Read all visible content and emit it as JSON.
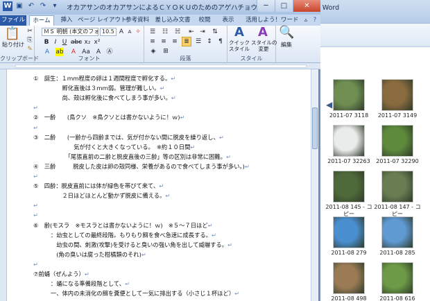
{
  "word": {
    "title": "オカアサンのオカアサンによるＣＹＯＫＵのためのアゲハチョウ観察日記 - Microsoft Word",
    "window_controls": {
      "minimize": "─",
      "maximize": "□",
      "close": "✕"
    },
    "tabs": [
      "ファイル",
      "ホーム",
      "挿入",
      "ページ レイアウト",
      "参考資料",
      "差し込み文書",
      "校閲",
      "表示",
      "活用しよう！ワード"
    ],
    "ribbon": {
      "paste_label": "貼り付け",
      "clipboard_group": "クリップボード",
      "font_name": "ＭＳ 明朝 (本文のフォン",
      "font_size": "10.5",
      "font_group": "フォント",
      "paragraph_group": "段落",
      "quick_style_label": "クイック\nスタイル",
      "change_style_label": "スタイルの\n変更",
      "style_group": "スタイル",
      "edit_label": "編集"
    },
    "document_lines": [
      "①　誕生：１ｍｍ程度の卵は１週間程度で孵化する。",
      "　　　　　孵化直後は３ｍｍ弱。管理が難しい。",
      "　　　　　尚、殻は孵化後に食べてしまう事が多い。",
      "",
      "②　一齢　　(鳥クソ　※鳥クソとは書かないように！ｗ)",
      "",
      "③　二齢　　(一齢から四齢までは、気が付かない間に脱皮を繰り返し、",
      "　　　　　　　気が付くと大きくなっている。　※約１０日間",
      "　　　　　　「尾張直前の二齢と脱皮直後の三齢」等の区別は非常に困難。",
      "④　三齢　　　脱皮した皮は卵の殻同様、栄養があるので食べてしまう事が多い。)",
      "",
      "⑤　四齢：脱皮直前には体が緑色を帯びて来て、",
      "　　　　　２日ほどほとんど動かず脱皮に備える。",
      "",
      "",
      "⑥　齢(モスラ　※モスラとは書かないように！ｗ)　※５～７日ほど",
      "　　　：幼虫としての最終段階。もりもり餌を食べ急速に成長する。",
      "　　　　幼虫の間、刺激(攻撃)を受けると臭いの強い角を出して威嚇する。",
      "　　　　(角の臭いは腐った柑橘類のそれ)",
      "",
      "⑦前蛹（ぜんよう）",
      "　　　：蛹になる準備段階として、",
      "　　　一、体内の未消化の餌を糞便として一気に排出する（小さじ１杯ほど）"
    ]
  },
  "explorer": {
    "items": [
      {
        "label": "2011-07 3118",
        "color": "#6f8f52"
      },
      {
        "label": "2011-07 3149",
        "color": "#8a6b3f"
      },
      {
        "label": "2011-07 32263",
        "color": "#e9ecea"
      },
      {
        "label": "2011-07 32290",
        "color": "#5e8a3c"
      },
      {
        "label": "2011-08 145 - コピー",
        "color": "#4f6a3a"
      },
      {
        "label": "2011-08 147 - コピー",
        "color": "#6a7d52"
      },
      {
        "label": "2011-08 279",
        "color": "#4a8fd0"
      },
      {
        "label": "2011-08 285",
        "color": "#5f9ad3"
      },
      {
        "label": "2011-08 498",
        "color": "#9a7b55"
      },
      {
        "label": "2011-08 616",
        "color": "#6c9a46"
      }
    ]
  }
}
